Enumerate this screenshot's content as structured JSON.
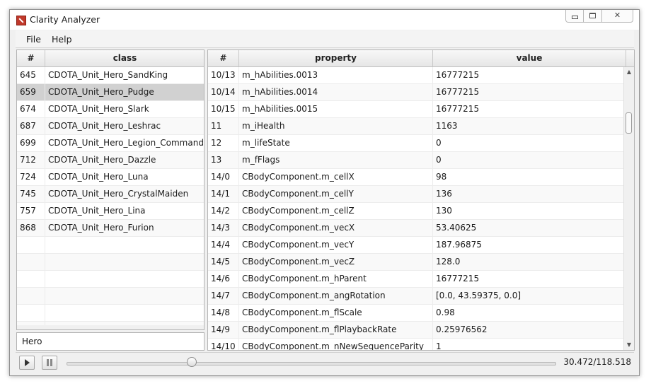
{
  "window": {
    "title": "Clarity Analyzer",
    "controls": {
      "minimize": "minimize",
      "maximize": "maximize",
      "close": "✕"
    }
  },
  "menu": [
    {
      "label": "File"
    },
    {
      "label": "Help"
    }
  ],
  "entity_table": {
    "columns": {
      "id": "#",
      "class": "class"
    },
    "rows": [
      {
        "id": "645",
        "class": "CDOTA_Unit_Hero_SandKing"
      },
      {
        "id": "659",
        "class": "CDOTA_Unit_Hero_Pudge",
        "selected": true
      },
      {
        "id": "674",
        "class": "CDOTA_Unit_Hero_Slark"
      },
      {
        "id": "687",
        "class": "CDOTA_Unit_Hero_Leshrac"
      },
      {
        "id": "699",
        "class": "CDOTA_Unit_Hero_Legion_Commander"
      },
      {
        "id": "712",
        "class": "CDOTA_Unit_Hero_Dazzle"
      },
      {
        "id": "724",
        "class": "CDOTA_Unit_Hero_Luna"
      },
      {
        "id": "745",
        "class": "CDOTA_Unit_Hero_CrystalMaiden"
      },
      {
        "id": "757",
        "class": "CDOTA_Unit_Hero_Lina"
      },
      {
        "id": "868",
        "class": "CDOTA_Unit_Hero_Furion"
      },
      {
        "id": "",
        "class": ""
      },
      {
        "id": "",
        "class": ""
      },
      {
        "id": "",
        "class": ""
      },
      {
        "id": "",
        "class": ""
      },
      {
        "id": "",
        "class": ""
      },
      {
        "id": "",
        "class": ""
      }
    ]
  },
  "filter_input": {
    "value": "Hero"
  },
  "property_table": {
    "columns": {
      "id": "#",
      "property": "property",
      "value": "value"
    },
    "rows": [
      {
        "id": "10/13",
        "property": "m_hAbilities.0013",
        "value": "16777215"
      },
      {
        "id": "10/14",
        "property": "m_hAbilities.0014",
        "value": "16777215"
      },
      {
        "id": "10/15",
        "property": "m_hAbilities.0015",
        "value": "16777215"
      },
      {
        "id": "11",
        "property": "m_iHealth",
        "value": "1163"
      },
      {
        "id": "12",
        "property": "m_lifeState",
        "value": "0"
      },
      {
        "id": "13",
        "property": "m_fFlags",
        "value": "0"
      },
      {
        "id": "14/0",
        "property": "CBodyComponent.m_cellX",
        "value": "98"
      },
      {
        "id": "14/1",
        "property": "CBodyComponent.m_cellY",
        "value": "136"
      },
      {
        "id": "14/2",
        "property": "CBodyComponent.m_cellZ",
        "value": "130"
      },
      {
        "id": "14/3",
        "property": "CBodyComponent.m_vecX",
        "value": "53.40625"
      },
      {
        "id": "14/4",
        "property": "CBodyComponent.m_vecY",
        "value": "187.96875"
      },
      {
        "id": "14/5",
        "property": "CBodyComponent.m_vecZ",
        "value": "128.0"
      },
      {
        "id": "14/6",
        "property": "CBodyComponent.m_hParent",
        "value": "16777215"
      },
      {
        "id": "14/7",
        "property": "CBodyComponent.m_angRotation",
        "value": "[0.0, 43.59375, 0.0]"
      },
      {
        "id": "14/8",
        "property": "CBodyComponent.m_flScale",
        "value": "0.98"
      },
      {
        "id": "14/9",
        "property": "CBodyComponent.m_flPlaybackRate",
        "value": "0.25976562"
      },
      {
        "id": "14/10",
        "property": "CBodyComponent.m_nNewSequenceParity",
        "value": "1"
      }
    ]
  },
  "playback": {
    "position_fraction": 0.257,
    "time_display": "30.472/118.518"
  }
}
